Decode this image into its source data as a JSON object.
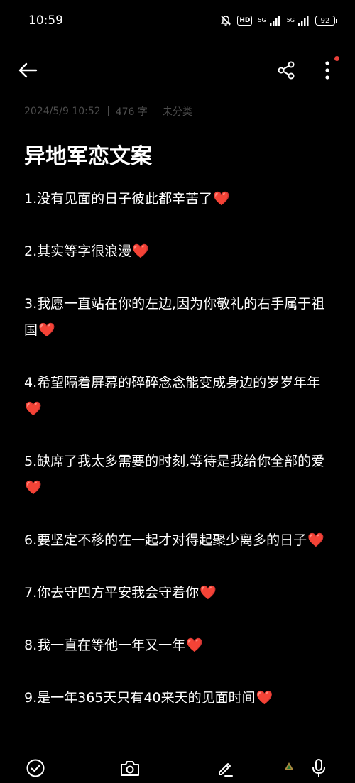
{
  "status_bar": {
    "time": "10:59",
    "hd": "HD",
    "net1": "5G",
    "net2": "5G",
    "battery": "92"
  },
  "note": {
    "date": "2024/5/9 10:52",
    "word_count": "476 字",
    "category": "未分类",
    "title": "异地军恋文案",
    "heart": "❤️",
    "paragraphs": [
      "1.没有见面的日子彼此都辛苦了",
      "2.其实等字很浪漫",
      "3.我愿一直站在你的左边,因为你敬礼的右手属于祖国",
      "4.希望隔着屏幕的碎碎念念能变成身边的岁岁年年",
      "5.缺席了我太多需要的时刻,等待是我给你全部的爱",
      "6.要坚定不移的在一起才对得起聚少离多的日子",
      "7.你去守四方平安我会守着你",
      "8.我一直在等他一年又一年",
      "9.是一年365天只有40来天的见面时间"
    ]
  },
  "colors": {
    "background": "#000000",
    "meta_text": "#4d4d4d",
    "heart": "#e23b3b",
    "badge_dot": "#e8403a"
  },
  "icons": {
    "back": "arrow-left-icon",
    "share": "share-icon",
    "more": "more-vertical-icon",
    "check": "check-circle-icon",
    "camera": "camera-icon",
    "pen": "pen-icon",
    "mic": "microphone-icon"
  }
}
